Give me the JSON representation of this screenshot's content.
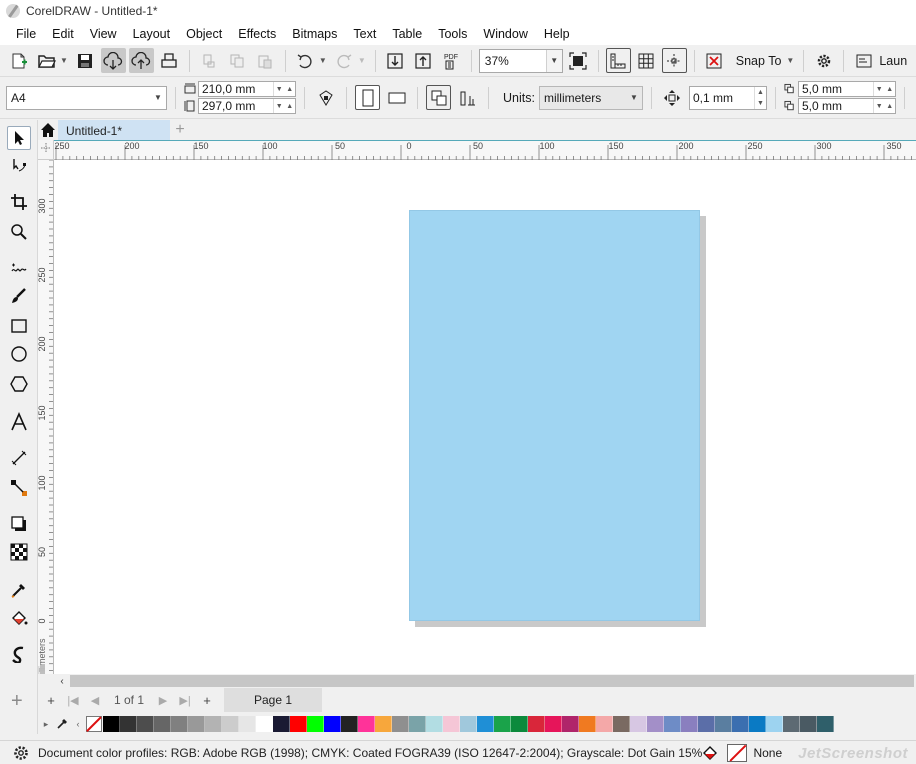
{
  "window": {
    "title": "CorelDRAW - Untitled-1*"
  },
  "menu": [
    "File",
    "Edit",
    "View",
    "Layout",
    "Object",
    "Effects",
    "Bitmaps",
    "Text",
    "Table",
    "Tools",
    "Window",
    "Help"
  ],
  "toolbar": {
    "pdf_label": "PDF",
    "zoom_value": "37%",
    "snap_label": "Snap To",
    "launch_label": "Laun"
  },
  "property_bar": {
    "page_size": "A4",
    "width": "210,0 mm",
    "height": "297,0 mm",
    "units_label": "Units:",
    "units_value": "millimeters",
    "nudge": "0,1 mm",
    "dup_x": "5,0 mm",
    "dup_y": "5,0 mm"
  },
  "document_tab": {
    "label": "Untitled-1*"
  },
  "ruler": {
    "h_labels": [
      "250",
      "200",
      "150",
      "100",
      "50",
      "0",
      "50",
      "100",
      "150",
      "200",
      "250",
      "300",
      "350"
    ],
    "v_labels": [
      "300",
      "250",
      "200",
      "150",
      "100",
      "50",
      "0"
    ],
    "unit_label": "millimeters"
  },
  "page_nav": {
    "count": "1 of 1",
    "page_tab": "Page 1"
  },
  "palette": {
    "colors": [
      "#000000",
      "#333333",
      "#4d4d4d",
      "#666666",
      "#808080",
      "#999999",
      "#b3b3b3",
      "#cccccc",
      "#e6e6e6",
      "#ffffff",
      "#1a1a33",
      "#ff0000",
      "#00ff00",
      "#0000ff",
      "#222222",
      "#ff3399",
      "#f7a73c",
      "#8f8f8f",
      "#7aa3a8",
      "#b2dde3",
      "#f5c6d6",
      "#a0c8dc",
      "#1f8fd6",
      "#1aa34a",
      "#0c8a3c",
      "#d9263a",
      "#e6155a",
      "#b0256a",
      "#f07a21",
      "#f4a8a8",
      "#7a6a62",
      "#d7c7e3",
      "#a38fc8",
      "#6e8cc6",
      "#8a7fbf",
      "#5b6ea8",
      "#5a7ea0",
      "#3b6fb0",
      "#0a7ac4",
      "#9dd3f0",
      "#5d6a73",
      "#4a5a63",
      "#2f5f6a"
    ]
  },
  "status": {
    "profiles": "Document color profiles: RGB: Adobe RGB (1998); CMYK: Coated FOGRA39 (ISO 12647-2:2004); Grayscale: Dot Gain 15%",
    "outline": "None",
    "watermark": "JetScreenshot"
  }
}
